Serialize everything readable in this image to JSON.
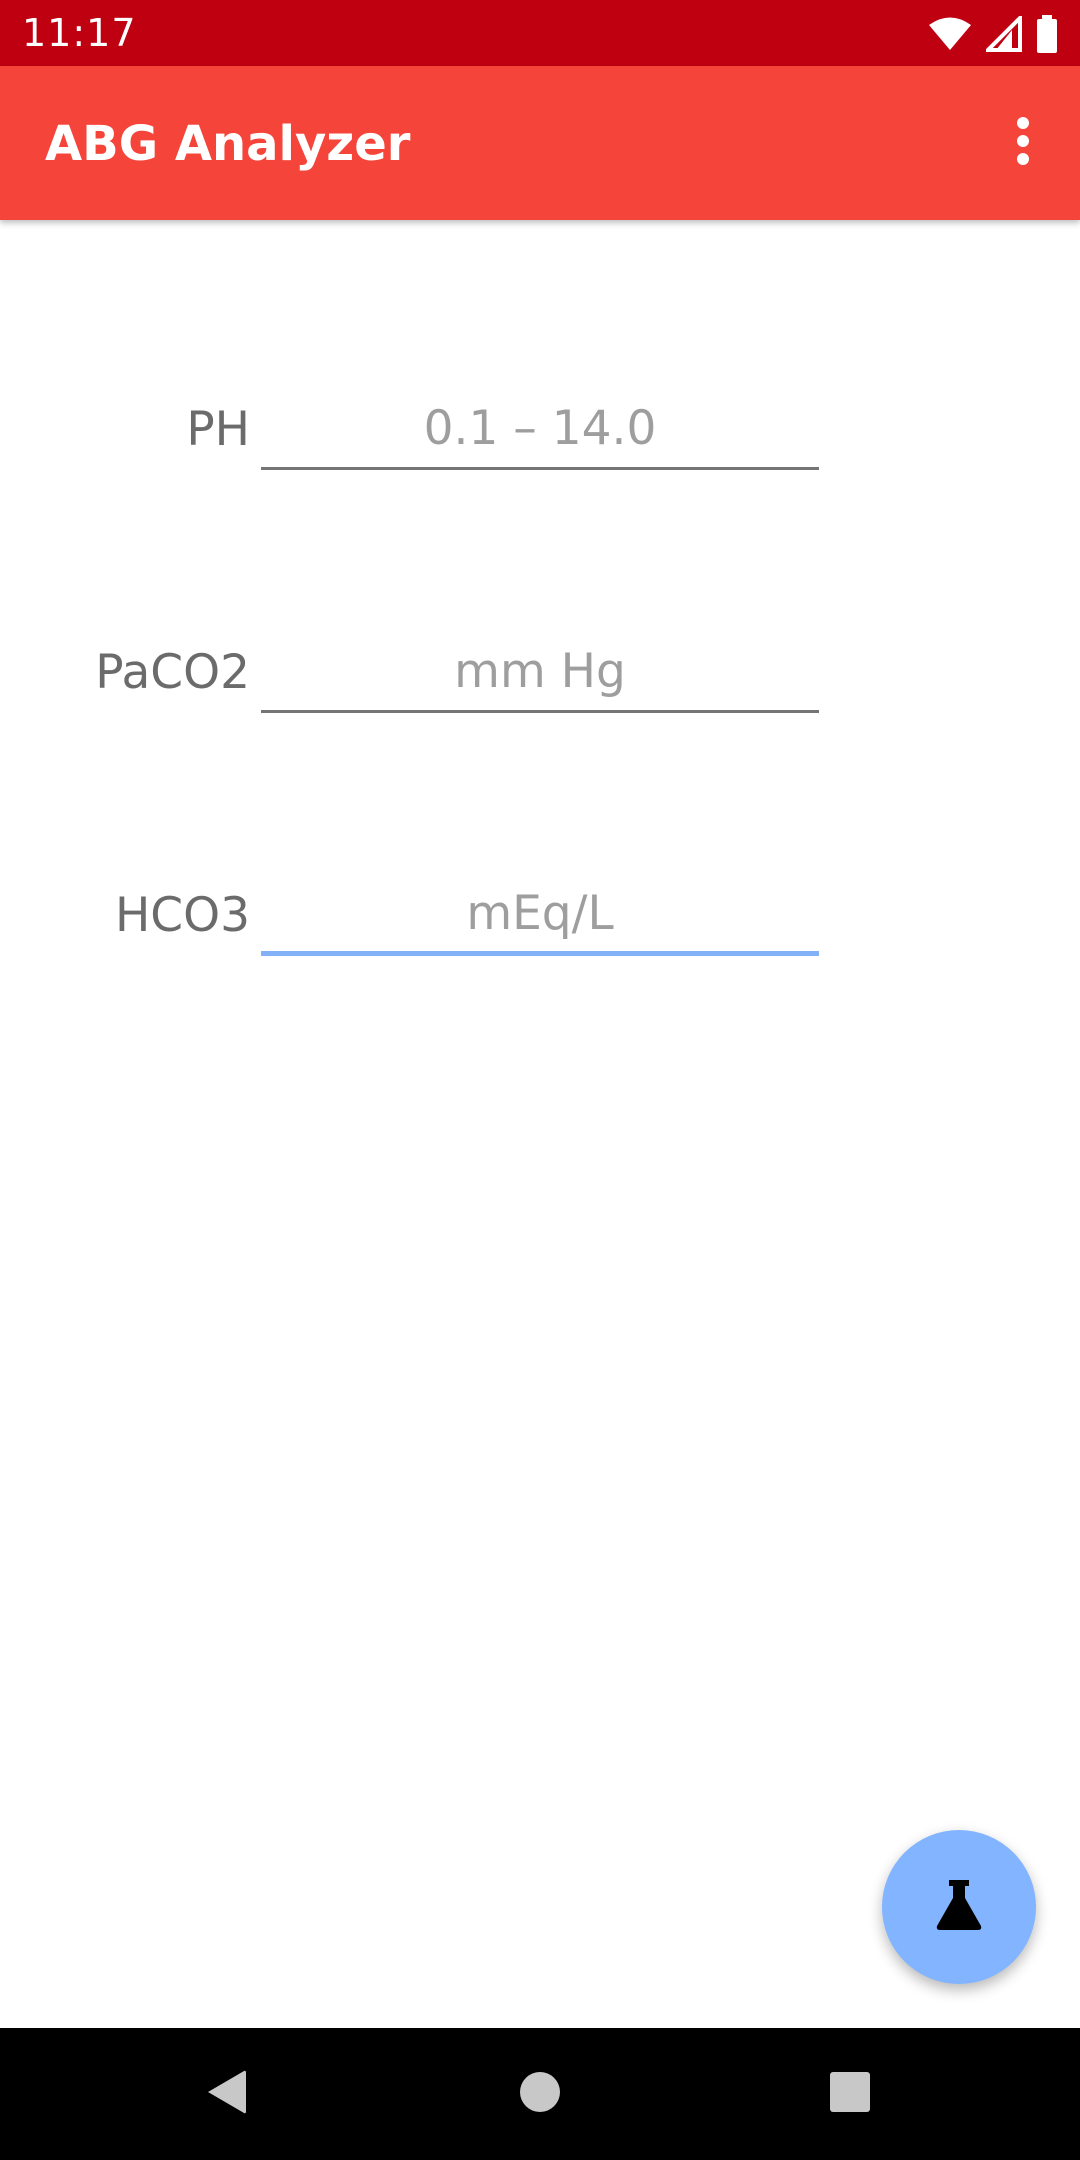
{
  "status_bar": {
    "time": "11:17",
    "icons": [
      "wifi-icon",
      "cell-signal-icon",
      "battery-icon"
    ]
  },
  "app_bar": {
    "title": "ABG Analyzer",
    "overflow_icon": "more-vert-icon"
  },
  "form": {
    "fields": [
      {
        "label": "PH",
        "value": "",
        "placeholder": "0.1 – 14.0"
      },
      {
        "label": "PaCO2",
        "value": "",
        "placeholder": "mm Hg"
      },
      {
        "label": "HCO3",
        "value": "",
        "placeholder": "mEq/L"
      }
    ]
  },
  "fab": {
    "icon": "flask-icon"
  },
  "nav_bar": {
    "icons": [
      "back-icon",
      "home-icon",
      "recents-icon"
    ]
  },
  "colors": {
    "status_bar": "#bf0011",
    "app_bar": "#f5443a",
    "fab": "#82b4ff",
    "focus_underline": "#82b1f7"
  }
}
